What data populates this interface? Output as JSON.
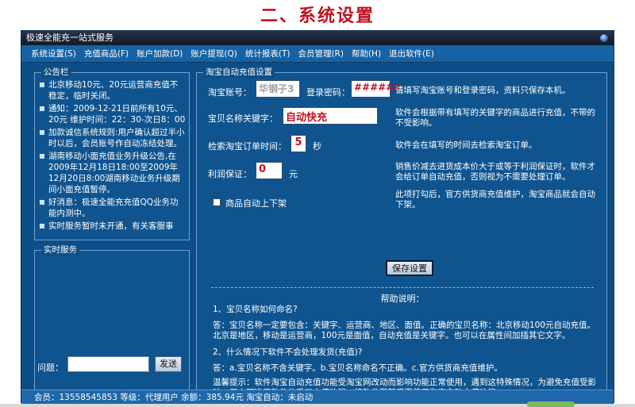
{
  "page": {
    "heading": "二、系统设置"
  },
  "window": {
    "title": "极速全能充一站式服务"
  },
  "menu": [
    "系统设置(S)",
    "充值商品(F)",
    "账户加款(D)",
    "账户提现(Q)",
    "统计报表(T)",
    "会员管理(R)",
    "帮助(H)",
    "退出软件(E)"
  ],
  "notice": {
    "title": "公告栏",
    "items": [
      "北京移动10元、20元运营商充值不稳定，临时关闭。",
      "通知：2009-12-21日前所有10元、20元 维护时间：22：30-次日8：00",
      "加款诚信系统规则:用户确认超过半小时以后，会员账号作自动冻结处理。",
      "湖南移动小面充值业务升级公告,在2009年12月18日18:00至2009年12月20日8:00湖南移动业务升级期间小面充值暂停。",
      "好消息：极速全能充充值QQ业务功能内测中。",
      "实时服务暂时未开通，有关客服事"
    ]
  },
  "realtime": {
    "title": "实时服务",
    "ask_label": "问题：",
    "ask_value": "",
    "send_label": "发送"
  },
  "taobao": {
    "title": "淘宝自动充值设置",
    "account_label": "淘宝账号：",
    "account_value": "华钢子3",
    "password_label": "登录密码：",
    "password_value": "######",
    "account_hint": "请填写淘宝账号和登录密码，资料只保存本机。",
    "keyword_label": "宝贝名称关键字：",
    "keyword_value": "自动快充",
    "keyword_hint": "软件会根据带有填写的关键字的商品进行充值，不带的不受影响。",
    "interval_label": "检索淘宝订单时间：",
    "interval_value": "5",
    "interval_unit": "秒",
    "interval_hint": "软件会在填写的时间去检索淘宝订单。",
    "profit_label": "利润保证：",
    "profit_value": "0",
    "profit_unit": "元",
    "profit_hint": "销售价减去进货成本价大于或等于利润保证时，软件才会给订单自动充值，否则视为不需要处理订单。",
    "auto_listing_label": "商品自动上下架",
    "auto_listing_checked": false,
    "auto_listing_hint": "此项打勾后，官方供货商充值维护，淘宝商品就会自动下架。",
    "save_label": "保存设置",
    "help_title": "帮助说明：",
    "help_q1": "1、宝贝名称如何命名?",
    "help_a1": "答：宝贝名称一定要包含：关键字、运营商、地区、面值。正确的宝贝名称：北京移动100元自动充值。北京是地区，移动是运营商，100元是面值，自动充值是关键字。也可以在属性间加插其它文字。",
    "help_q2": "2、什么情况下软件不会处理发货(充值)?",
    "help_a2": "答：a.宝贝名称不含关键字。b.宝贝名称命名不正确。c.官方供货商充值维护。",
    "help_tip": "温馨提示：软件淘宝自动充值功能受淘宝网改动而影响功能正常使用，遇到这特殊情况，为避免充值受影响，用户可选用软件的手工充值功能，待软件更新后再使用淘宝自动充值功能。"
  },
  "status": {
    "text": "会员：13558545853 等级：代理用户 余额：385.94元 淘宝自动：未启动"
  },
  "colors": {
    "window_bg": "#0d4e86",
    "heading": "#c1121f",
    "accent_red": "#c1121f"
  }
}
